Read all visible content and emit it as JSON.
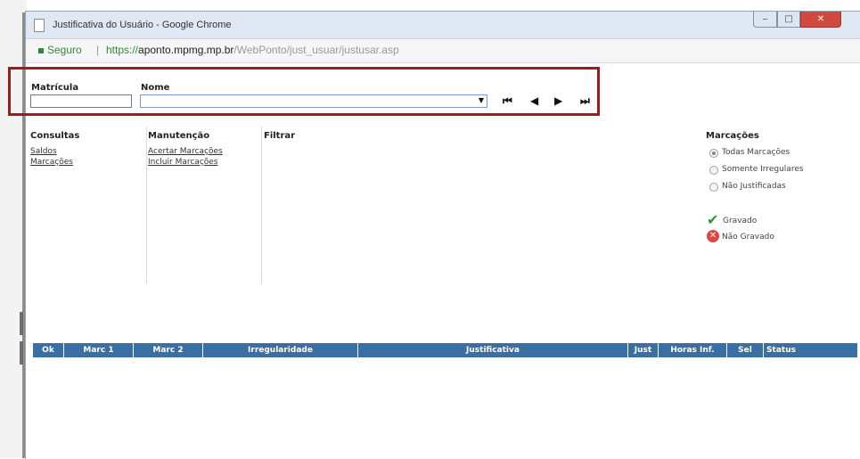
{
  "window": {
    "title": "Justificativa do Usuário - Google Chrome"
  },
  "address": {
    "secure_label": "Seguro",
    "separator": "|",
    "url_scheme": "https://",
    "url_host": "aponto.mpmg.mp.br",
    "url_path": "/WebPonto/just_usuar/justusar.asp"
  },
  "filters": {
    "matricula_label": "Matrícula",
    "matricula_value": "",
    "nome_label": "Nome",
    "nome_value": ""
  },
  "consultas": {
    "title": "Consultas",
    "links": [
      "Saldos",
      "Marcações"
    ]
  },
  "manutencao": {
    "title": "Manutenção",
    "links": [
      "Acertar Marcações",
      "Incluir Marcações"
    ]
  },
  "filtrar": {
    "title": "Filtrar"
  },
  "marcacoes": {
    "title": "Marcações",
    "options": [
      "Todas Marcações",
      "Somente Irregulares",
      "Não Justificadas"
    ],
    "selected_index": 0,
    "legend_ok": "Gravado",
    "legend_not": "Não Gravado"
  },
  "table": {
    "headers": [
      "Ok",
      "Marc 1",
      "Marc 2",
      "Irregularidade",
      "Justificativa",
      "Just",
      "Horas Inf.",
      "Sel",
      "Status"
    ]
  },
  "colors": {
    "table_header": "#3a6fa3",
    "highlight_box": "#9b1c1c",
    "secure": "#2e8b35"
  }
}
